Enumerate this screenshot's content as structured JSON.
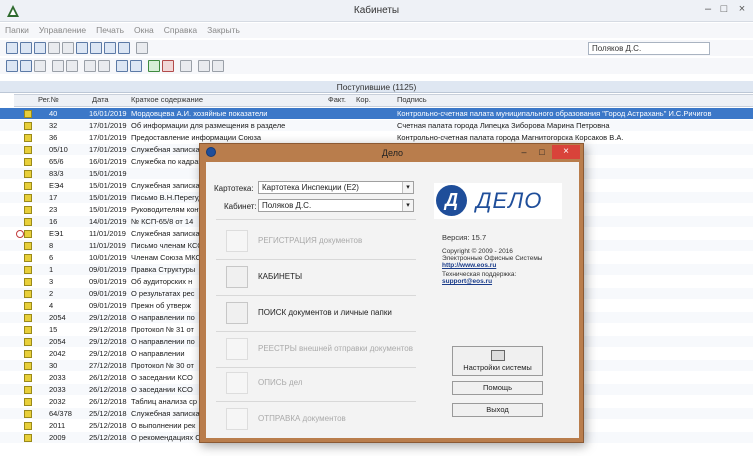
{
  "window": {
    "title": "Кабинеты",
    "min": "–",
    "max": "□",
    "close": "×"
  },
  "menu": [
    "Папки",
    "Управление",
    "Печать",
    "Окна",
    "Справка",
    "Закрыть"
  ],
  "user_field": "Поляков Д.С.",
  "grid": {
    "title": "Поступившие (1125)",
    "columns": [
      "Рег.№",
      "Дата",
      "Краткое содержание",
      "Факт.",
      "Кор.",
      "Подпись"
    ],
    "rows": [
      {
        "num": "40",
        "date": "16/01/2019",
        "text": "Мордовцева А.И. хозяйные показатели",
        "extra": "Контрольно-счетная палата муниципального образования \"Город Астрахань\" И.С.Ричигов",
        "sel": true
      },
      {
        "num": "32",
        "date": "17/01/2019",
        "text": "Об информации для размещения в разделе",
        "extra": "Счетная палата города Липецка Зиборова Марина Петровна"
      },
      {
        "num": "36",
        "date": "17/01/2019",
        "text": "Предоставление информации Союза",
        "extra": "Контрольно-счетная палата города Магнитогорска Корсаков В.А."
      },
      {
        "num": "05/10",
        "date": "17/01/2019",
        "text": "Служебная записка",
        "extra": ""
      },
      {
        "num": "65/6",
        "date": "16/01/2019",
        "text": "Служебка по кадрам",
        "extra": ""
      },
      {
        "num": "83/3",
        "date": "15/01/2019",
        "text": "",
        "extra": ""
      },
      {
        "num": "ЕЭ4",
        "date": "15/01/2019",
        "text": "Служебная записка",
        "extra": ""
      },
      {
        "num": "17",
        "date": "15/01/2019",
        "text": "Письмо В.Н.Перегуд",
        "extra": ""
      },
      {
        "num": "23",
        "date": "15/01/2019",
        "text": "Руководителям контр.",
        "extra": ""
      },
      {
        "num": "16",
        "date": "14/01/2019",
        "text": "№ КСП-65/8 от 14",
        "extra": "ование город Краснодар-П.И.Байшева"
      },
      {
        "num": "ЕЭ1",
        "date": "11/01/2019",
        "text": "Служебная записка",
        "extra": "",
        "mark": true
      },
      {
        "num": "8",
        "date": "11/01/2019",
        "text": "Письмо членам КСО",
        "extra": "род Камышин Волгоградской области-Бакин"
      },
      {
        "num": "6",
        "date": "10/01/2019",
        "text": "Членам Союза МКО",
        "extra": "ону Каргашин В.М."
      },
      {
        "num": "1",
        "date": "09/01/2019",
        "text": "Правка Структуры",
        "extra": ""
      },
      {
        "num": "3",
        "date": "09/01/2019",
        "text": "Об аудиторских н",
        "extra": ""
      },
      {
        "num": "2",
        "date": "09/01/2019",
        "text": "О результатах рес",
        "extra": "страции Волгограда-Радько И.В."
      },
      {
        "num": "4",
        "date": "09/01/2019",
        "text": "Прежн об утверж",
        "extra": ""
      },
      {
        "num": "2054",
        "date": "29/12/2018",
        "text": "О направлении по",
        "extra": "ой администрации Волгограда-Елисеева А.М."
      },
      {
        "num": "15",
        "date": "29/12/2018",
        "text": "Протокол № 31 от",
        "extra": "редседателя"
      },
      {
        "num": "2054",
        "date": "29/12/2018",
        "text": "О направлении по",
        "extra": "ой администрации Волгограда-Елисеева А.М."
      },
      {
        "num": "2042",
        "date": "29/12/2018",
        "text": "О направлении",
        "extra": ""
      },
      {
        "num": "30",
        "date": "27/12/2018",
        "text": "Протокол № 30 от",
        "extra": ""
      },
      {
        "num": "2033",
        "date": "26/12/2018",
        "text": "О заседании КСО",
        "extra": ""
      },
      {
        "num": "2033",
        "date": "26/12/2018",
        "text": "О заседании КСО",
        "extra": ""
      },
      {
        "num": "2032",
        "date": "26/12/2018",
        "text": "Таблиц анализа ср",
        "extra": "ии Волгограда (ДГХ)-Комков С.П."
      },
      {
        "num": "64/378",
        "date": "25/12/2018",
        "text": "Служебная записка",
        "extra": ""
      },
      {
        "num": "2011",
        "date": "25/12/2018",
        "text": "О выполнении рек",
        "extra": ""
      },
      {
        "num": "2009",
        "date": "25/12/2018",
        "text": "О рекомендациях Союза МКСО в б.Ф.З. 131-ФЗ",
        "extra": "Руководитель Скороходов Петр В.И."
      }
    ]
  },
  "dialog": {
    "title": "Дело",
    "kartoteka_label": "Картотека:",
    "kartoteka_value": "Картотека Инспекции (Е2)",
    "kabinet_label": "Кабинет:",
    "kabinet_value": "Поляков Д.С.",
    "menu": [
      {
        "label": "РЕГИСТРАЦИЯ  документов",
        "disabled": true,
        "icon": "register-icon"
      },
      {
        "label": "КАБИНЕТЫ",
        "disabled": false,
        "icon": "cabinets-icon"
      },
      {
        "label": "ПОИСК  документов и личные папки",
        "disabled": false,
        "icon": "search-icon"
      },
      {
        "label": "РЕЕСТРЫ  внешней отправки документов",
        "disabled": true,
        "icon": "registry-icon"
      },
      {
        "label": "ОПИСЬ дел",
        "disabled": true,
        "icon": "inventory-icon"
      },
      {
        "label": "ОТПРАВКА документов",
        "disabled": true,
        "icon": "send-icon"
      }
    ],
    "logo_letter": "Д",
    "logo_word": "ДЕЛО",
    "version": "Версия: 15.7",
    "copyright": "Copyright © 2009 - 2016",
    "company": "Электронные Офисные Системы",
    "site": "http://www.eos.ru",
    "support_label": "Техническая поддержка:",
    "support_email": "support@eos.ru",
    "btn_settings": "Настройки системы",
    "btn_help": "Помощь",
    "btn_exit": "Выход"
  }
}
